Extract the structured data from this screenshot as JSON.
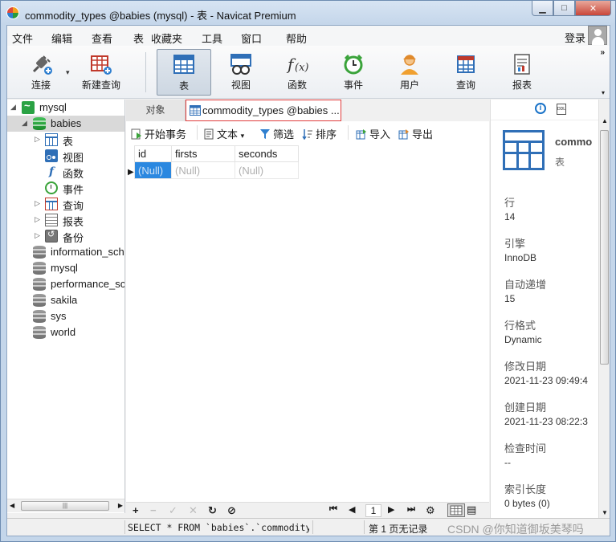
{
  "window": {
    "title": "commodity_types @babies (mysql) - 表 - Navicat Premium",
    "min_glyph": "▁",
    "max_glyph": "□",
    "close_glyph": "✕"
  },
  "menu": {
    "items": [
      "文件",
      "编辑",
      "查看",
      "表",
      "收藏夹",
      "工具",
      "窗口",
      "帮助"
    ],
    "login": "登录"
  },
  "toolbar": {
    "connect": "连接",
    "new_query": "新建查询",
    "table": "表",
    "view": "视图",
    "function": "函数",
    "event": "事件",
    "user": "用户",
    "query": "查询",
    "report": "报表",
    "overflow": "»",
    "overflow_down": "▾",
    "dropdown": "▾"
  },
  "tree": {
    "items": [
      {
        "label": "mysql",
        "icon": "connection-icon",
        "arrow": "◢"
      },
      {
        "label": "babies",
        "icon": "database-icon",
        "arrow": "◢"
      },
      {
        "label": "表",
        "icon": "table-icon",
        "arrow": "▷"
      },
      {
        "label": "视图",
        "icon": "view-icon",
        "arrow": ""
      },
      {
        "label": "函数",
        "icon": "function-icon",
        "arrow": ""
      },
      {
        "label": "事件",
        "icon": "event-icon",
        "arrow": ""
      },
      {
        "label": "查询",
        "icon": "query-icon",
        "arrow": "▷"
      },
      {
        "label": "报表",
        "icon": "report-icon",
        "arrow": "▷"
      },
      {
        "label": "备份",
        "icon": "backup-icon",
        "arrow": "▷"
      },
      {
        "label": "information_sch",
        "icon": "database-icon",
        "arrow": ""
      },
      {
        "label": "mysql",
        "icon": "database-icon",
        "arrow": ""
      },
      {
        "label": "performance_sc",
        "icon": "database-icon",
        "arrow": ""
      },
      {
        "label": "sakila",
        "icon": "database-icon",
        "arrow": ""
      },
      {
        "label": "sys",
        "icon": "database-icon",
        "arrow": ""
      },
      {
        "label": "world",
        "icon": "database-icon",
        "arrow": ""
      }
    ],
    "scroll_left": "◀",
    "scroll_right": "▶",
    "scroll_grip": "|||"
  },
  "tabs": {
    "objects": "对象",
    "table_tab": "commodity_types @babies ..."
  },
  "subtoolbar": {
    "begin_transaction": "开始事务",
    "text": "文本",
    "text_dropdown": "▾",
    "filter": "筛选",
    "sort": "排序",
    "import": "导入",
    "export": "导出"
  },
  "grid": {
    "columns": [
      "id",
      "firsts",
      "seconds"
    ],
    "rows": [
      [
        "(Null)",
        "(Null)",
        "(Null)"
      ]
    ],
    "row_marker": "▶"
  },
  "bottombar": {
    "add": "+",
    "remove": "−",
    "apply": "✓",
    "discard": "✕",
    "refresh": "↻",
    "stop": "⊘",
    "first": "⏮",
    "prev": "◀",
    "page": "1",
    "next": "▶",
    "last": "⏭",
    "settings": "⚙",
    "form_view": "▤"
  },
  "info": {
    "info_glyph": "i",
    "ddl_label": "DDL",
    "name": "commo",
    "type": "表",
    "fields": [
      {
        "label": "行",
        "value": "14"
      },
      {
        "label": "引擎",
        "value": "InnoDB"
      },
      {
        "label": "自动递增",
        "value": "15"
      },
      {
        "label": "行格式",
        "value": "Dynamic"
      },
      {
        "label": "修改日期",
        "value": "2021-11-23 09:49:4"
      },
      {
        "label": "创建日期",
        "value": "2021-11-23 08:22:3"
      },
      {
        "label": "检查时间",
        "value": "--"
      },
      {
        "label": "索引长度",
        "value": "0 bytes (0)"
      }
    ]
  },
  "scrollbar": {
    "up": "▲",
    "down": "▼"
  },
  "status": {
    "sql": "SELECT * FROM `babies`.`commodity_t",
    "page_info": "第 1 页无记录",
    "watermark": "CSDN @你知道御坂美琴吗"
  },
  "colors": {
    "accent": "#2f6fb7",
    "selection": "#2b88e0",
    "tab_highlight": "#e03c3c"
  }
}
